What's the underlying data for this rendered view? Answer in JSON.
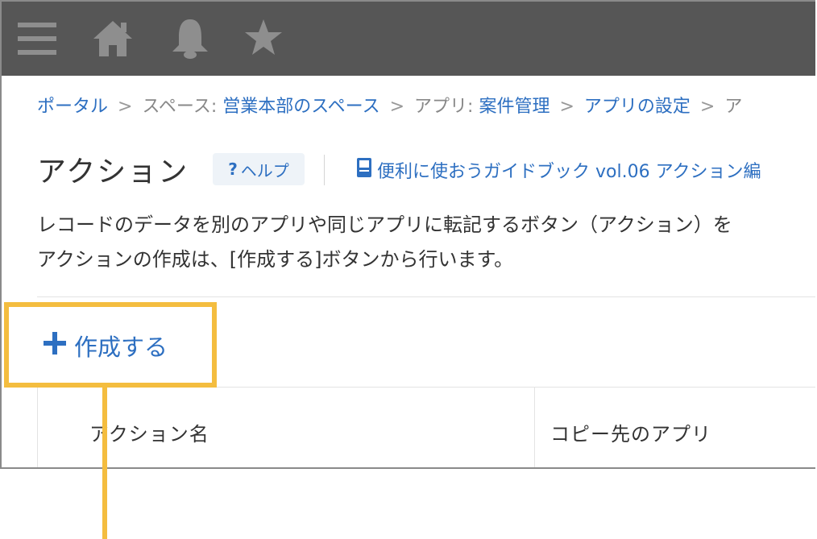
{
  "topbar": {
    "icons": [
      "menu-icon",
      "home-icon",
      "bell-icon",
      "star-icon"
    ]
  },
  "breadcrumb": {
    "portal": "ポータル",
    "space_prefix": "スペース: ",
    "space_name": "営業本部のスペース",
    "app_prefix": "アプリ: ",
    "app_name": "案件管理",
    "settings": "アプリの設定",
    "separator": ">",
    "trailing": "ア"
  },
  "header": {
    "title": "アクション",
    "help_q": "?",
    "help_label": "ヘルプ",
    "guide_link": "便利に使おうガイドブック vol.06 アクション編"
  },
  "description": {
    "line1": "レコードのデータを別のアプリや同じアプリに転記するボタン（アクション）を",
    "line2": "アクションの作成は、[作成する]ボタンから行います。"
  },
  "create_button": {
    "plus": "+",
    "label": "作成する"
  },
  "table": {
    "columns": [
      "アクション名",
      "コピー先のアプリ"
    ]
  },
  "colors": {
    "topbar": "#565656",
    "link": "#2d6fc1",
    "highlight": "#f4bd3f"
  }
}
